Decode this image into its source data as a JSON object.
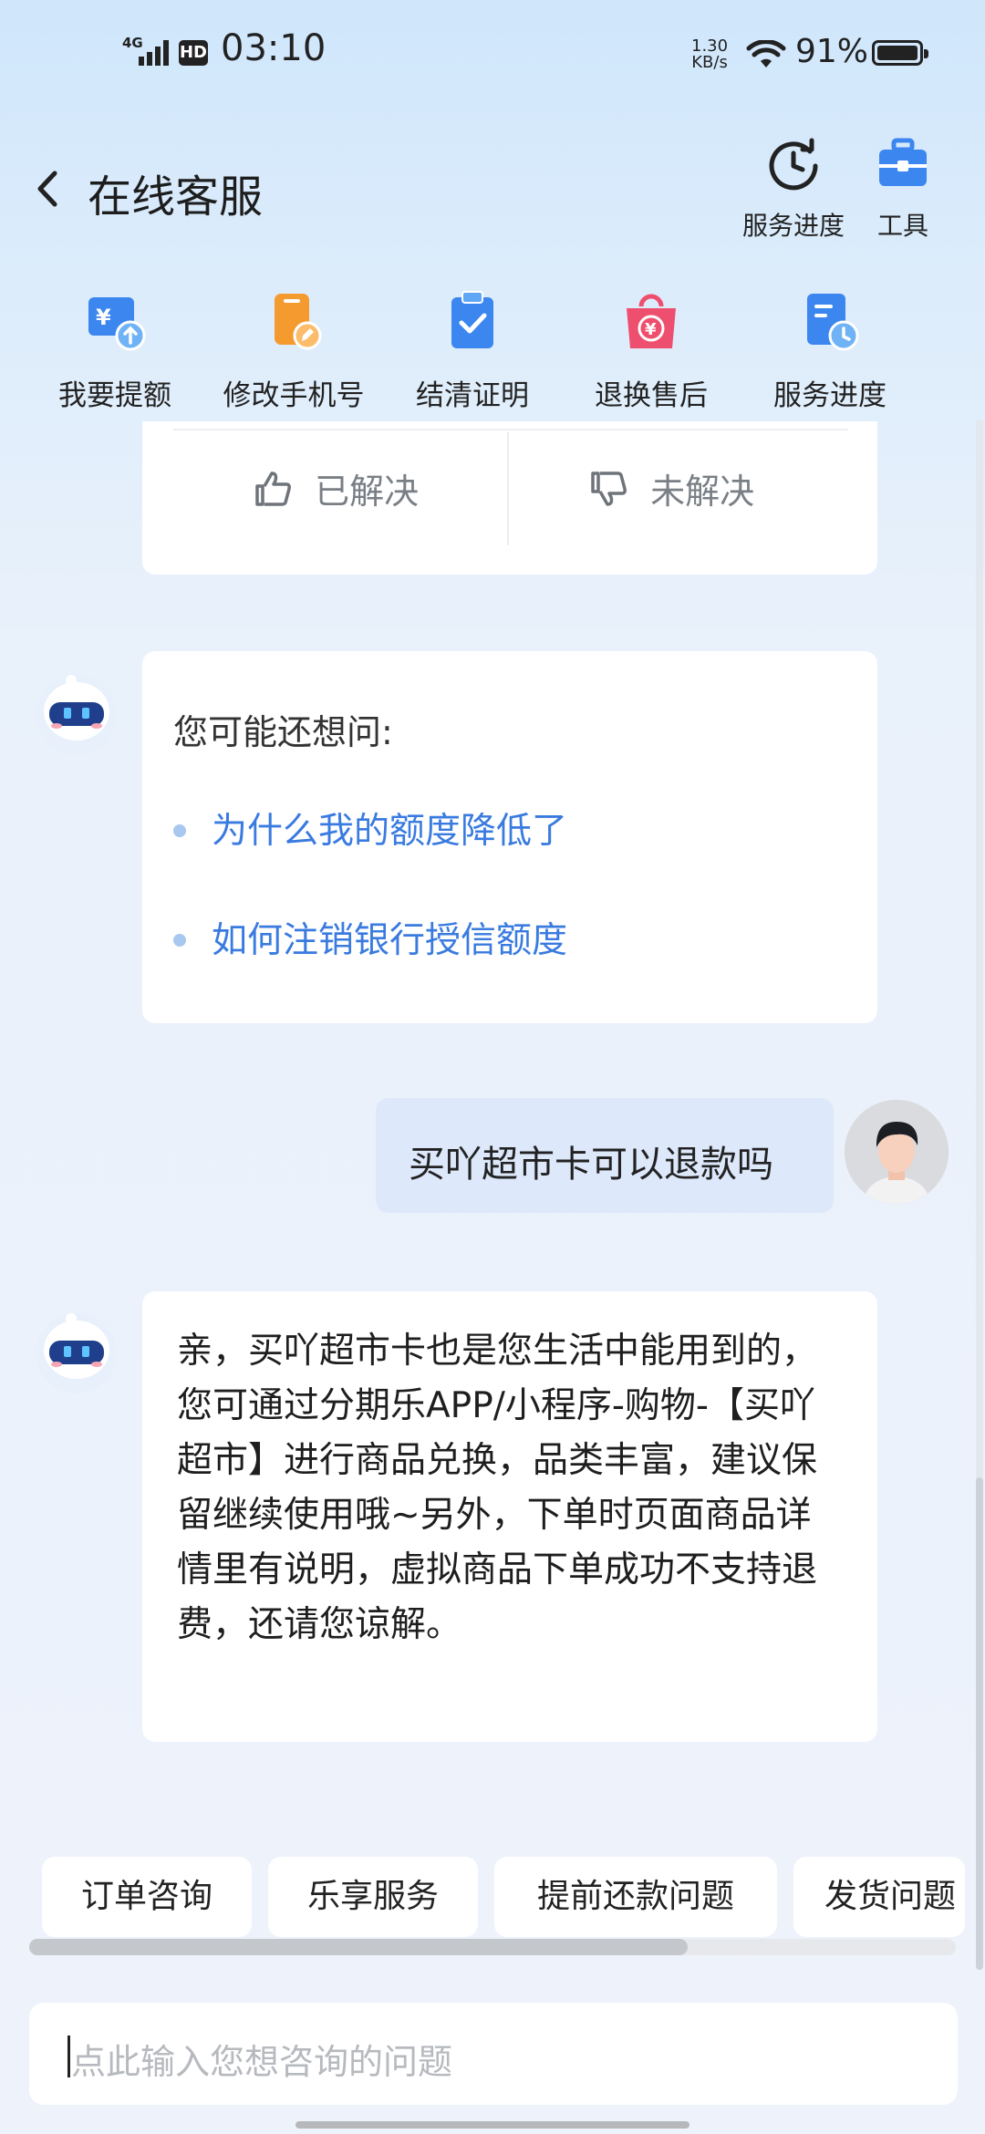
{
  "status_bar": {
    "network": "4G",
    "hd": "HD",
    "time": "03:10",
    "speed_value": "1.30",
    "speed_unit": "KB/s",
    "battery": "91%"
  },
  "header": {
    "title": "在线客服",
    "actions": [
      {
        "label": "服务进度",
        "icon": "clock-refresh-icon"
      },
      {
        "label": "工具",
        "icon": "toolbox-icon"
      }
    ]
  },
  "quick_actions": [
    {
      "label": "我要提额",
      "icon": "wallet-up-icon"
    },
    {
      "label": "修改手机号",
      "icon": "phone-edit-icon"
    },
    {
      "label": "结清证明",
      "icon": "clipboard-check-icon"
    },
    {
      "label": "退换售后",
      "icon": "refund-bag-icon"
    },
    {
      "label": "服务进度",
      "icon": "document-clock-icon"
    }
  ],
  "feedback": {
    "resolved": "已解决",
    "unresolved": "未解决"
  },
  "faq": {
    "heading": "您可能还想问:",
    "items": [
      "为什么我的额度降低了",
      "如何注销银行授信额度"
    ]
  },
  "user_message": "买吖超市卡可以退款吗",
  "bot_reply": "亲，买吖超市卡也是您生活中能用到的，您可通过分期乐APP/小程序-购物-【买吖超市】进行商品兑换，品类丰富，建议保留继续使用哦~另外，下单时页面商品详情里有说明，虚拟商品下单成功不支持退费，还请您谅解。",
  "chips": [
    "订单咨询",
    "乐享服务",
    "提前还款问题",
    "发货问题"
  ],
  "input": {
    "placeholder": "点此输入您想咨询的问题"
  },
  "colors": {
    "accent_blue": "#3a7be0",
    "icon_blue": "#3b86ef",
    "icon_orange": "#f59a2f",
    "icon_pink": "#ef4f6e",
    "user_bubble": "#dde8fb"
  }
}
